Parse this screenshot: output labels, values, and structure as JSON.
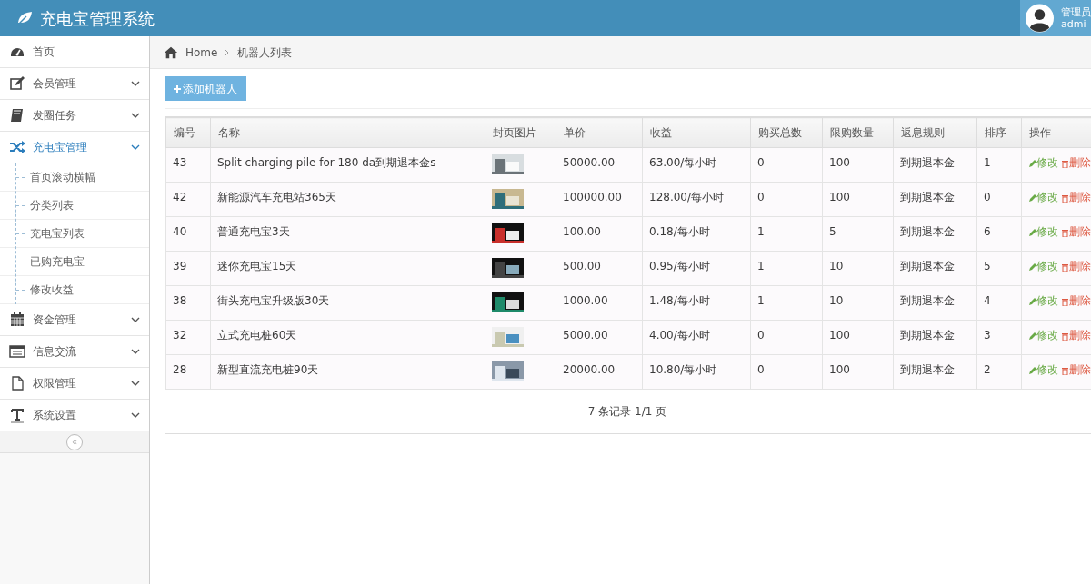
{
  "header": {
    "title": "充电宝管理系统",
    "user_role": "管理员",
    "user_name": "admi"
  },
  "sidebar": {
    "items": [
      {
        "label": "首页",
        "kind": "link",
        "selected": false
      },
      {
        "label": "会员管理",
        "kind": "group",
        "selected": false
      },
      {
        "label": "发圈任务",
        "kind": "group",
        "selected": false
      },
      {
        "label": "充电宝管理",
        "kind": "group",
        "selected": true,
        "children": [
          {
            "label": "首页滚动横幅"
          },
          {
            "label": "分类列表"
          },
          {
            "label": "充电宝列表"
          },
          {
            "label": "已购充电宝"
          },
          {
            "label": "修改收益"
          }
        ]
      },
      {
        "label": "资金管理",
        "kind": "group",
        "selected": false
      },
      {
        "label": "信息交流",
        "kind": "group",
        "selected": false
      },
      {
        "label": "权限管理",
        "kind": "group",
        "selected": false
      },
      {
        "label": "系统设置",
        "kind": "group",
        "selected": false
      }
    ],
    "collapse": "«"
  },
  "breadcrumb": [
    {
      "label": "Home"
    },
    {
      "label": "机器人列表"
    }
  ],
  "add_button": "添加机器人",
  "table": {
    "columns": [
      "编号",
      "名称",
      "封页图片",
      "单价",
      "收益",
      "购买总数",
      "限购数量",
      "返息规则",
      "排序",
      "操作"
    ],
    "rows": [
      {
        "id": "43",
        "name": "Split charging pile for 180 da到期退本金s",
        "price": "50000.00",
        "income": "63.00/每小时",
        "bought": "0",
        "limit": "100",
        "rule": "到期退本金",
        "sort": "1",
        "actions": [
          {
            "label": "修改",
            "kind": "edit"
          },
          {
            "label": "删除",
            "kind": "delete"
          }
        ]
      },
      {
        "id": "42",
        "name": "新能源汽车充电站365天",
        "price": "100000.00",
        "income": "128.00/每小时",
        "bought": "0",
        "limit": "100",
        "rule": "到期退本金",
        "sort": "0",
        "actions": [
          {
            "label": "修改",
            "kind": "edit"
          },
          {
            "label": "删除",
            "kind": "delete"
          }
        ]
      },
      {
        "id": "40",
        "name": "普通充电宝3天",
        "price": "100.00",
        "income": "0.18/每小时",
        "bought": "1",
        "limit": "5",
        "rule": "到期退本金",
        "sort": "6",
        "actions": [
          {
            "label": "修改",
            "kind": "edit"
          },
          {
            "label": "删除",
            "kind": "delete"
          }
        ]
      },
      {
        "id": "39",
        "name": "迷你充电宝15天",
        "price": "500.00",
        "income": "0.95/每小时",
        "bought": "1",
        "limit": "10",
        "rule": "到期退本金",
        "sort": "5",
        "actions": [
          {
            "label": "修改",
            "kind": "edit"
          },
          {
            "label": "删除",
            "kind": "delete"
          }
        ]
      },
      {
        "id": "38",
        "name": "街头充电宝升级版30天",
        "price": "1000.00",
        "income": "1.48/每小时",
        "bought": "1",
        "limit": "10",
        "rule": "到期退本金",
        "sort": "4",
        "actions": [
          {
            "label": "修改",
            "kind": "edit"
          },
          {
            "label": "删除",
            "kind": "delete"
          }
        ]
      },
      {
        "id": "32",
        "name": "立式充电桩60天",
        "price": "5000.00",
        "income": "4.00/每小时",
        "bought": "0",
        "limit": "100",
        "rule": "到期退本金",
        "sort": "3",
        "actions": [
          {
            "label": "修改",
            "kind": "edit"
          },
          {
            "label": "删除",
            "kind": "delete"
          }
        ]
      },
      {
        "id": "28",
        "name": "新型直流充电桩90天",
        "price": "20000.00",
        "income": "10.80/每小时",
        "bought": "0",
        "limit": "100",
        "rule": "到期退本金",
        "sort": "2",
        "actions": [
          {
            "label": "修改",
            "kind": "edit"
          },
          {
            "label": "删除",
            "kind": "delete"
          }
        ]
      }
    ]
  },
  "pagination": "7 条记录 1/1 页"
}
